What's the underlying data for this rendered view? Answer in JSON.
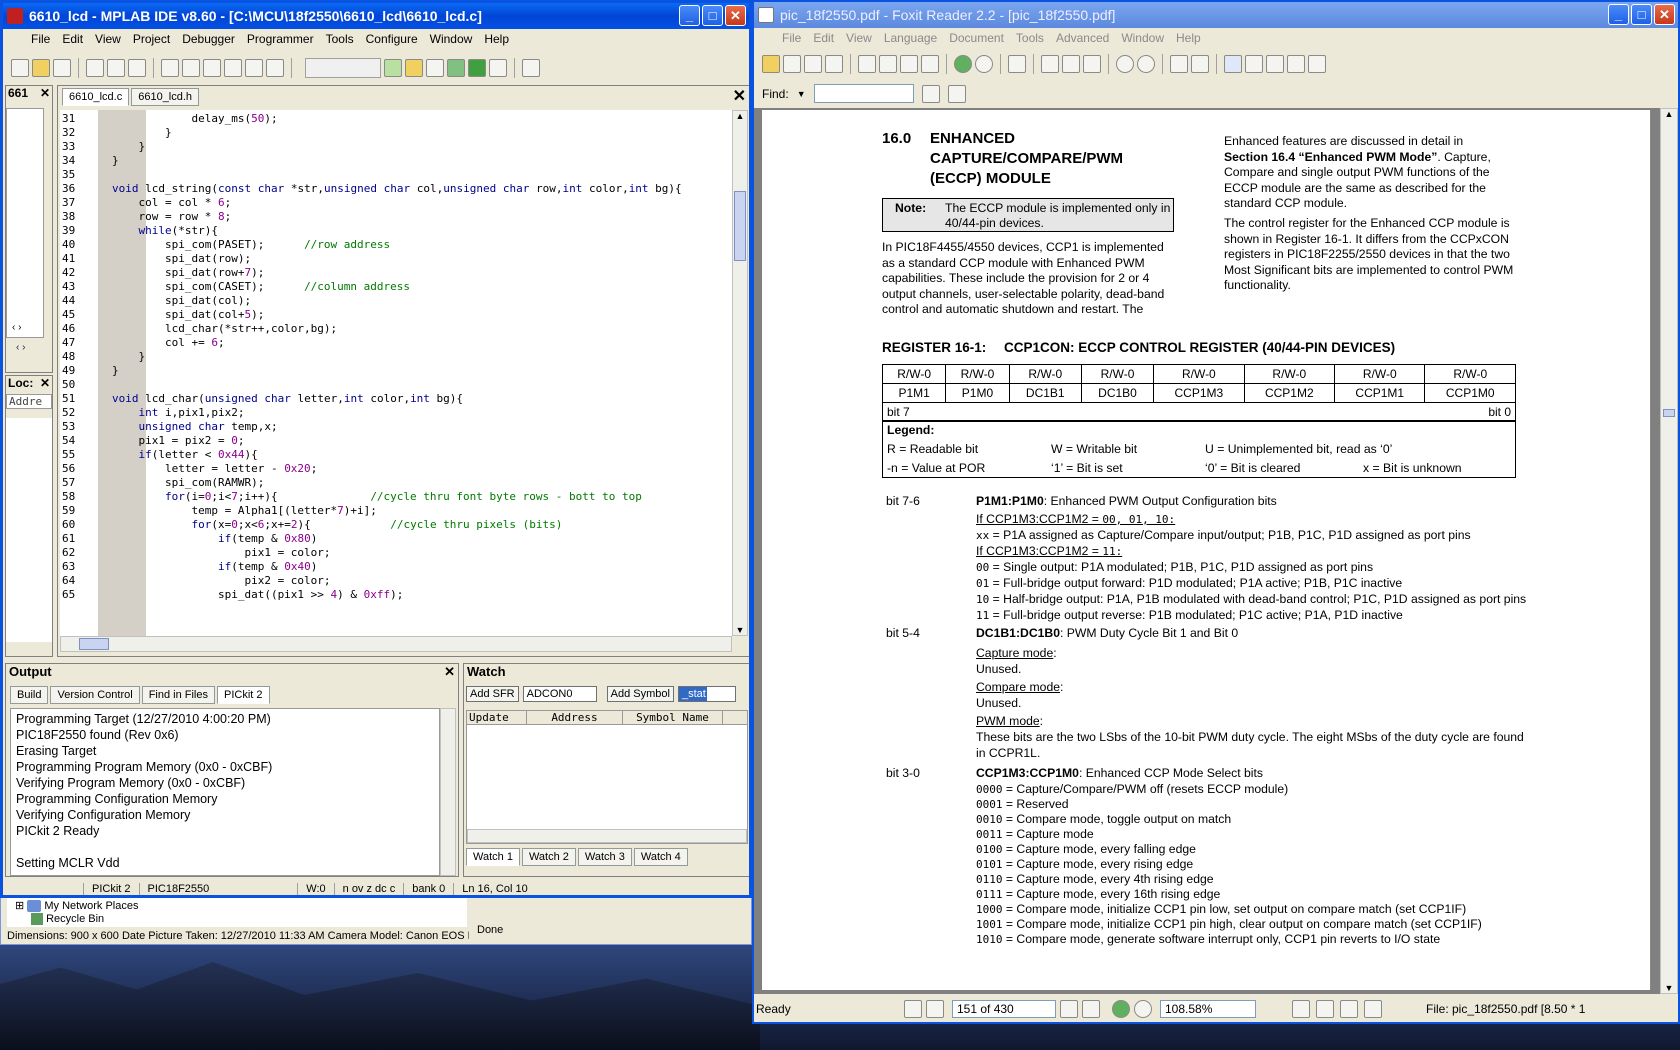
{
  "mplab": {
    "title": "6610_lcd - MPLAB IDE v8.60 - [C:\\MCU\\18f2550\\6610_lcd\\6610_lcd.c]",
    "menu": [
      "File",
      "Edit",
      "View",
      "Project",
      "Debugger",
      "Programmer",
      "Tools",
      "Configure",
      "Window",
      "Help"
    ],
    "left_tab1": "661",
    "left_tab2": "Loc:",
    "left_col": "Addre",
    "editor_tabs": [
      "6610_lcd.c",
      "6610_lcd.h"
    ],
    "code": [
      [
        "31",
        "            delay_ms(50);"
      ],
      [
        "32",
        "        }"
      ],
      [
        "33",
        "    }"
      ],
      [
        "34",
        "}"
      ],
      [
        "35",
        ""
      ],
      [
        "36",
        "void lcd_string(const char *str,unsigned char col,unsigned char row,int color,int bg){"
      ],
      [
        "37",
        "    col = col * 6;"
      ],
      [
        "38",
        "    row = row * 8;"
      ],
      [
        "39",
        "    while(*str){"
      ],
      [
        "40",
        "        spi_com(PASET);      //row address"
      ],
      [
        "41",
        "        spi_dat(row);"
      ],
      [
        "42",
        "        spi_dat(row+7);"
      ],
      [
        "43",
        "        spi_com(CASET);      //column address"
      ],
      [
        "44",
        "        spi_dat(col);"
      ],
      [
        "45",
        "        spi_dat(col+5);"
      ],
      [
        "46",
        "        lcd_char(*str++,color,bg);"
      ],
      [
        "47",
        "        col += 6;"
      ],
      [
        "48",
        "    }"
      ],
      [
        "49",
        "}"
      ],
      [
        "50",
        ""
      ],
      [
        "51",
        "void lcd_char(unsigned char letter,int color,int bg){"
      ],
      [
        "52",
        "    int i,pix1,pix2;"
      ],
      [
        "53",
        "    unsigned char temp,x;"
      ],
      [
        "54",
        "    pix1 = pix2 = 0;"
      ],
      [
        "55",
        "    if(letter < 0x44){"
      ],
      [
        "56",
        "        letter = letter - 0x20;"
      ],
      [
        "57",
        "        spi_com(RAMWR);"
      ],
      [
        "58",
        "        for(i=0;i<7;i++){              //cycle thru font byte rows - bott to top"
      ],
      [
        "59",
        "            temp = Alpha1[(letter*7)+i];"
      ],
      [
        "60",
        "            for(x=0;x<6;x+=2){            //cycle thru pixels (bits)"
      ],
      [
        "61",
        "                if(temp & 0x80)"
      ],
      [
        "62",
        "                    pix1 = color;"
      ],
      [
        "63",
        "                if(temp & 0x40)"
      ],
      [
        "64",
        "                    pix2 = color;"
      ],
      [
        "65",
        "                spi_dat((pix1 >> 4) & 0xff);"
      ]
    ],
    "output": {
      "title": "Output",
      "tabs": [
        "Build",
        "Version Control",
        "Find in Files",
        "PICkit 2"
      ],
      "lines": [
        "Programming Target (12/27/2010  4:00:20 PM)",
        "PIC18F2550 found (Rev 0x6)",
        "Erasing Target",
        "Programming Program Memory (0x0 - 0xCBF)",
        "Verifying Program Memory (0x0 - 0xCBF)",
        "Programming Configuration Memory",
        "Verifying Configuration Memory",
        "PICkit 2 Ready",
        "",
        "Setting MCLR Vdd"
      ]
    },
    "watch": {
      "title": "Watch",
      "add_sfr": "Add SFR",
      "sfr_value": "ADCON0",
      "add_symbol": "Add Symbol",
      "symbol_value": "_stat",
      "columns": [
        "Update",
        "Address",
        "Symbol Name"
      ],
      "tabs": [
        "Watch 1",
        "Watch 2",
        "Watch 3",
        "Watch 4"
      ]
    },
    "status": [
      "PICkit 2",
      "PIC18F2550",
      "W:0",
      "n ov z dc c",
      "bank 0",
      "Ln 16, Col 10"
    ]
  },
  "explorer": {
    "items": [
      "My Network Places",
      "Recycle Bin"
    ],
    "status": "Dimensions: 900 x 600 Date Picture Taken: 12/27/2010 11:33 AM Camera Model: Canon EOS REB",
    "done": "Done"
  },
  "foxit": {
    "title": "pic_18f2550.pdf - Foxit Reader 2.2 - [pic_18f2550.pdf]",
    "menu": [
      "File",
      "Edit",
      "View",
      "Language",
      "Document",
      "Tools",
      "Advanced",
      "Window",
      "Help"
    ],
    "find_label": "Find:",
    "status_ready": "Ready",
    "page": "151 of 430",
    "zoom": "108.58%",
    "file_info": "File: pic_18f2550.pdf [8.50 * 1",
    "doc": {
      "sec_num": "16.0",
      "sec_title": [
        "ENHANCED",
        "CAPTURE/COMPARE/PWM",
        "(ECCP) MODULE"
      ],
      "note_label": "Note:",
      "note": [
        "The ECCP module is implemented only in",
        "40/44-pin devices."
      ],
      "left_para": [
        "In PIC18F4455/4550 devices, CCP1 is implemented",
        "as a standard CCP module with Enhanced PWM",
        "capabilities. These include the provision for 2 or 4",
        "output channels, user-selectable polarity, dead-band",
        "control and automatic shutdown and restart. The"
      ],
      "right_para1_a": "Enhanced features are discussed in detail in",
      "right_para1_b1": "Section 16.4 “Enhanced PWM Mode”",
      "right_para1_b2": ". Capture,",
      "right_para1_rest": [
        "Compare and single output PWM functions of the",
        "ECCP module are the same as described for the",
        "standard CCP module."
      ],
      "right_para2": [
        "The control register for the Enhanced CCP module is",
        "shown in Register 16-1. It differs from the CCPxCON",
        "registers in PIC18F2255/2550 devices in that the two",
        "Most Significant bits are implemented to control PWM",
        "functionality."
      ],
      "reg_label": "REGISTER 16-1:",
      "reg_title": "CCP1CON: ECCP CONTROL REGISTER (40/44-PIN DEVICES)",
      "reg_rw": [
        "R/W-0",
        "R/W-0",
        "R/W-0",
        "R/W-0",
        "R/W-0",
        "R/W-0",
        "R/W-0",
        "R/W-0"
      ],
      "reg_bits": [
        "P1M1",
        "P1M0",
        "DC1B1",
        "DC1B0",
        "CCP1M3",
        "CCP1M2",
        "CCP1M1",
        "CCP1M0"
      ],
      "bit7": "bit 7",
      "bit0": "bit 0",
      "legend_title": "Legend:",
      "legend": [
        "R = Readable bit",
        "W = Writable bit",
        "U = Unimplemented bit, read as ‘0’",
        "-n = Value at POR",
        "‘1’ = Bit is set",
        "‘0’ = Bit is cleared",
        "x = Bit is unknown"
      ],
      "b76": "bit 7-6",
      "b76_name": "P1M1:P1M0",
      "b76_desc": ": Enhanced PWM Output Configuration bits",
      "b76_if1": "If CCP1M3:CCP1M2 = ",
      "b76_if1_v": "00, 01, 10:",
      "b76_xx_c": "xx",
      "b76_xx": " = P1A assigned as Capture/Compare input/output; P1B, P1C, P1D assigned as port pins",
      "b76_if2": "If CCP1M3:CCP1M2 = ",
      "b76_if2_v": "11:",
      "b76_opts": [
        [
          "00",
          " = Single output: P1A modulated; P1B, P1C, P1D assigned as port pins"
        ],
        [
          "01",
          " = Full-bridge output forward: P1D modulated; P1A active; P1B, P1C inactive"
        ],
        [
          "10",
          " = Half-bridge output: P1A, P1B modulated with dead-band control; P1C, P1D assigned as port pins"
        ],
        [
          "11",
          " = Full-bridge output reverse: P1B modulated; P1C active; P1A, P1D inactive"
        ]
      ],
      "b54": "bit 5-4",
      "b54_name": "DC1B1:DC1B0",
      "b54_desc": ": PWM Duty Cycle Bit 1 and Bit 0",
      "cap_mode": "Capture mode",
      "cap_colon": ":",
      "unused1": "Unused.",
      "cmp_mode": "Compare mode",
      "cmp_colon": ":",
      "unused2": "Unused.",
      "pwm_mode": "PWM mode",
      "pwm_colon": ":",
      "pwm_desc": [
        "These bits are the two LSbs of the 10-bit PWM duty cycle. The eight MSbs of the duty cycle are found",
        "in CCPR1L."
      ],
      "b30": "bit 3-0",
      "b30_name": "CCP1M3:CCP1M0",
      "b30_desc": ": Enhanced CCP Mode Select bits",
      "b30_opts": [
        [
          "0000",
          " = Capture/Compare/PWM off (resets ECCP module)"
        ],
        [
          "0001",
          " = Reserved"
        ],
        [
          "0010",
          " = Compare mode, toggle output on match"
        ],
        [
          "0011",
          " = Capture mode"
        ],
        [
          "0100",
          " = Capture mode, every falling edge"
        ],
        [
          "0101",
          " = Capture mode, every rising edge"
        ],
        [
          "0110",
          " = Capture mode, every 4th rising edge"
        ],
        [
          "0111",
          " = Capture mode, every 16th rising edge"
        ],
        [
          "1000",
          " = Compare mode, initialize CCP1 pin low, set output on compare match (set CCP1IF)"
        ],
        [
          "1001",
          " = Compare mode, initialize CCP1 pin high, clear output on compare match (set CCP1IF)"
        ],
        [
          "1010",
          " = Compare mode, generate software interrupt only, CCP1 pin reverts to I/O state"
        ]
      ]
    }
  }
}
